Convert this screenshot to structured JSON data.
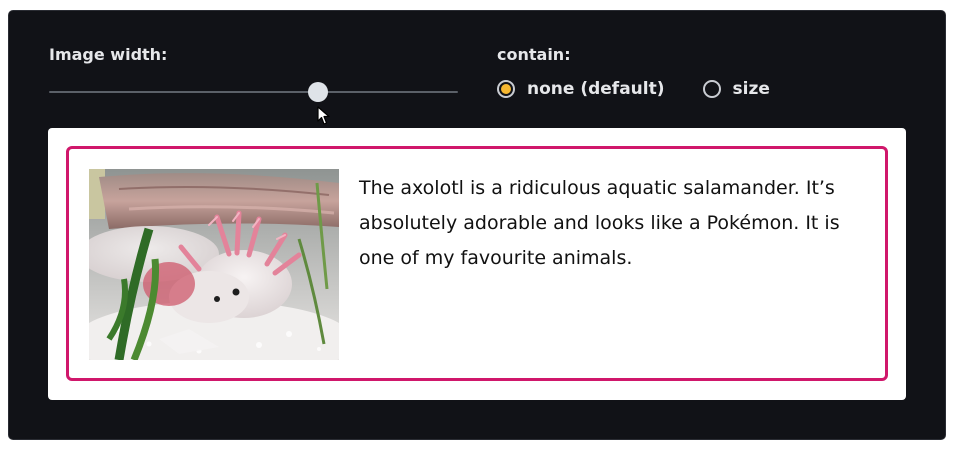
{
  "controls": {
    "width_label": "Image width:",
    "width_slider_value": 0.657,
    "contain_label": "contain:",
    "contain_options": [
      {
        "label": "none (default)",
        "selected": true
      },
      {
        "label": "size",
        "selected": false
      }
    ]
  },
  "preview": {
    "image_subject": "axolotl",
    "paragraph": "The axolotl is a ridiculous aquatic salamander. It’s absolutely adorable and looks like a Pokémon. It is one of my favourite animals."
  },
  "colors": {
    "panel_bg": "#111217",
    "radio_selected": "#f5b731",
    "card_border": "#d0176b"
  },
  "icons": {
    "cursor": "arrow-cursor-icon"
  }
}
